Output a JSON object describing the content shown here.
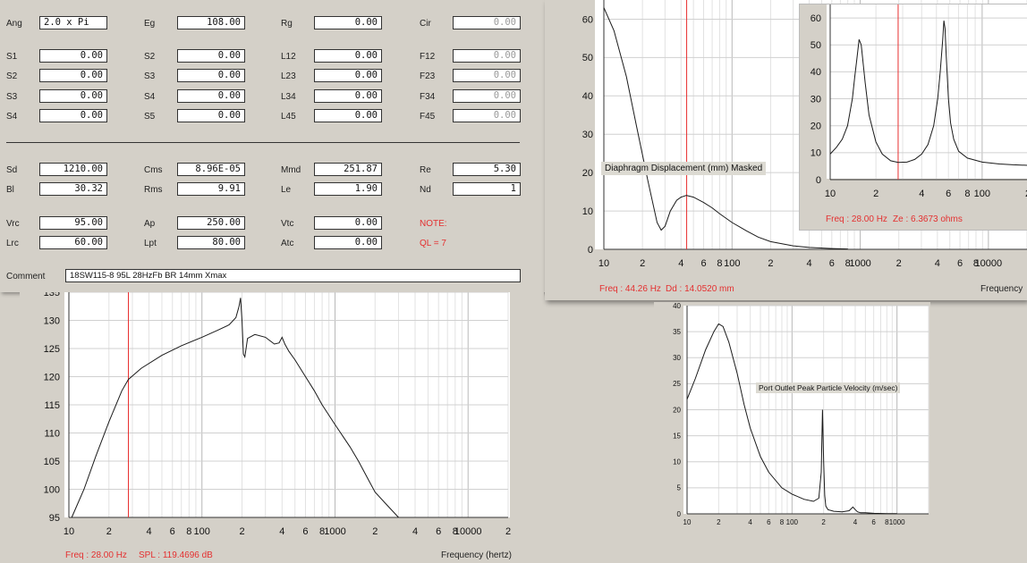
{
  "params": {
    "rows": [
      {
        "key": "ang",
        "cells": [
          {
            "label": "Ang",
            "value": "2.0 x Pi",
            "left": true
          },
          {
            "label": "Eg",
            "value": "108.00"
          },
          {
            "label": "Rg",
            "value": "0.00"
          },
          {
            "label": "Cir",
            "value": "0.00",
            "dim": true
          }
        ]
      },
      {
        "key": "s1",
        "cells": [
          {
            "label": "S1",
            "value": "0.00"
          },
          {
            "label": "S2",
            "value": "0.00"
          },
          {
            "label": "L12",
            "value": "0.00"
          },
          {
            "label": "F12",
            "value": "0.00",
            "dim": true
          }
        ]
      },
      {
        "key": "s2",
        "cells": [
          {
            "label": "S2",
            "value": "0.00"
          },
          {
            "label": "S3",
            "value": "0.00"
          },
          {
            "label": "L23",
            "value": "0.00"
          },
          {
            "label": "F23",
            "value": "0.00",
            "dim": true
          }
        ]
      },
      {
        "key": "s3",
        "cells": [
          {
            "label": "S3",
            "value": "0.00"
          },
          {
            "label": "S4",
            "value": "0.00"
          },
          {
            "label": "L34",
            "value": "0.00"
          },
          {
            "label": "F34",
            "value": "0.00",
            "dim": true
          }
        ]
      },
      {
        "key": "s4",
        "cells": [
          {
            "label": "S4",
            "value": "0.00"
          },
          {
            "label": "S5",
            "value": "0.00"
          },
          {
            "label": "L45",
            "value": "0.00"
          },
          {
            "label": "F45",
            "value": "0.00",
            "dim": true
          }
        ]
      },
      {
        "key": "sd",
        "cells": [
          {
            "label": "Sd",
            "value": "1210.00"
          },
          {
            "label": "Cms",
            "value": "8.96E-05"
          },
          {
            "label": "Mmd",
            "value": "251.87"
          },
          {
            "label": "Re",
            "value": "5.30"
          }
        ]
      },
      {
        "key": "bl",
        "cells": [
          {
            "label": "Bl",
            "value": "30.32"
          },
          {
            "label": "Rms",
            "value": "9.91"
          },
          {
            "label": "Le",
            "value": "1.90"
          },
          {
            "label": "Nd",
            "value": "1"
          }
        ]
      },
      {
        "key": "vrc",
        "cells": [
          {
            "label": "Vrc",
            "value": "95.00"
          },
          {
            "label": "Ap",
            "value": "250.00"
          },
          {
            "label": "Vtc",
            "value": "0.00"
          },
          {
            "label": "NOTE:",
            "value": "",
            "note": true
          }
        ]
      },
      {
        "key": "lrc",
        "cells": [
          {
            "label": "Lrc",
            "value": "60.00"
          },
          {
            "label": "Lpt",
            "value": "80.00"
          },
          {
            "label": "Atc",
            "value": "0.00"
          },
          {
            "label": "QL = 7",
            "value": "",
            "note": true
          }
        ]
      }
    ],
    "comment_label": "Comment",
    "comment_value": "18SW115-8  95L 28HzFb BR 14mm Xmax"
  },
  "spl_chart": {
    "freq_readout": "Freq : 28.00 Hz",
    "spl_readout": "SPL : 119.4696 dB",
    "x_axis_label": "Frequency (hertz)"
  },
  "disp_chart": {
    "overlay_label": "Diaphragm Displacement (mm)   Masked",
    "freq_readout": "Freq : 44.26 Hz",
    "dd_readout": "Dd : 14.0520 mm",
    "x_axis_label": "Frequency"
  },
  "imp_chart": {
    "freq_readout": "Freq : 28.00 Hz",
    "ze_readout": "Ze : 6.3673 ohms"
  },
  "vel_chart": {
    "overlay_label": "Port Outlet Peak Particle Velocity (m/sec)"
  },
  "chart_data": [
    {
      "type": "line",
      "id": "spl",
      "title": "",
      "xlabel": "Frequency (hertz)",
      "ylabel": "",
      "x_scale": "log",
      "xlim": [
        10,
        20000
      ],
      "ylim": [
        95,
        135
      ],
      "y_ticks": [
        95,
        100,
        105,
        110,
        115,
        120,
        125,
        130,
        135
      ],
      "x_tick_labels": [
        "10",
        "2",
        "4",
        "6",
        "8",
        "100",
        "2",
        "4",
        "6",
        "8",
        "1000",
        "2",
        "4",
        "6",
        "8",
        "10000",
        "2"
      ],
      "x_tick_values": [
        10,
        20,
        40,
        60,
        80,
        100,
        200,
        400,
        600,
        800,
        1000,
        2000,
        4000,
        6000,
        8000,
        10000,
        20000
      ],
      "cursor_x": 28,
      "grid": true,
      "series": [
        {
          "x": [
            10.5,
            13,
            16,
            20,
            25,
            28,
            35,
            50,
            70,
            100,
            130,
            160,
            180,
            190,
            195,
            200,
            205,
            210,
            220,
            250,
            300,
            350,
            380,
            400,
            420,
            450,
            500,
            600,
            700,
            800,
            1000,
            1300,
            1500,
            1800,
            2000,
            2500,
            3000
          ],
          "y": [
            95,
            100,
            106,
            112,
            117.5,
            119.5,
            121.5,
            123.8,
            125.5,
            127,
            128.2,
            129.2,
            130.5,
            132.5,
            134,
            130,
            124,
            123.5,
            126.8,
            127.5,
            127,
            125.8,
            126,
            127,
            125.8,
            124.5,
            123,
            120,
            117.5,
            115,
            111.5,
            107.5,
            105,
            101.5,
            99.5,
            97,
            95
          ]
        }
      ]
    },
    {
      "type": "line",
      "id": "displacement",
      "title": "",
      "xlabel": "Frequency",
      "ylabel": "",
      "x_scale": "log",
      "xlim": [
        10,
        20000
      ],
      "ylim": [
        0,
        65
      ],
      "y_ticks": [
        0,
        10,
        20,
        30,
        40,
        50,
        60
      ],
      "x_tick_labels": [
        "10",
        "2",
        "4",
        "6",
        "8",
        "100",
        "2",
        "4",
        "6",
        "8",
        "1000",
        "2",
        "4",
        "6",
        "8",
        "10000"
      ],
      "x_tick_values": [
        10,
        20,
        40,
        60,
        80,
        100,
        200,
        400,
        600,
        800,
        1000,
        2000,
        4000,
        6000,
        8000,
        10000
      ],
      "cursor_x": 44.26,
      "grid": true,
      "series": [
        {
          "x": [
            10,
            12,
            15,
            18,
            22,
            26,
            28,
            30,
            33,
            37,
            40,
            44,
            50,
            60,
            70,
            80,
            100,
            130,
            160,
            200,
            300,
            400,
            600,
            800
          ],
          "y": [
            63,
            57,
            45,
            32,
            18,
            7,
            5,
            6,
            10,
            12.8,
            13.6,
            14.05,
            13.6,
            12.2,
            10.8,
            9.3,
            7,
            4.8,
            3.2,
            2,
            0.9,
            0.5,
            0.2,
            0.1
          ]
        }
      ]
    },
    {
      "type": "line",
      "id": "impedance",
      "title": "",
      "xlabel": "",
      "ylabel": "",
      "x_scale": "log",
      "xlim": [
        10,
        200
      ],
      "ylim": [
        0,
        65
      ],
      "y_ticks": [
        0,
        10,
        20,
        30,
        40,
        50,
        60
      ],
      "x_tick_labels": [
        "10",
        "2",
        "4",
        "6",
        "8",
        "100",
        "2"
      ],
      "x_tick_values": [
        10,
        20,
        40,
        60,
        80,
        100,
        200
      ],
      "cursor_x": 28,
      "grid": true,
      "series": [
        {
          "x": [
            10,
            11,
            12,
            13,
            14,
            14.5,
            15,
            15.5,
            16,
            17,
            18,
            20,
            22,
            25,
            28,
            32,
            36,
            40,
            44,
            48,
            51,
            53,
            55,
            56,
            57,
            58,
            60,
            62,
            65,
            70,
            80,
            100,
            130,
            160,
            200
          ],
          "y": [
            9.5,
            12,
            15,
            20,
            30,
            38,
            45,
            52,
            50,
            36,
            24,
            14,
            9.5,
            7,
            6.37,
            6.5,
            7.5,
            9.5,
            13,
            20,
            30,
            40,
            52,
            59,
            56,
            46,
            30,
            21,
            15,
            10.5,
            8,
            6.5,
            5.8,
            5.5,
            5.3
          ]
        }
      ]
    },
    {
      "type": "line",
      "id": "port_velocity",
      "title": "Port Outlet Peak Particle Velocity (m/sec)",
      "xlabel": "",
      "ylabel": "",
      "x_scale": "log",
      "xlim": [
        10,
        2000
      ],
      "ylim": [
        0,
        40
      ],
      "y_ticks": [
        0,
        5,
        10,
        15,
        20,
        25,
        30,
        35,
        40
      ],
      "x_tick_labels": [
        "10",
        "2",
        "4",
        "6",
        "8",
        "100",
        "2",
        "4",
        "6",
        "8",
        "1000"
      ],
      "x_tick_values": [
        10,
        20,
        40,
        60,
        80,
        100,
        200,
        400,
        600,
        800,
        1000
      ],
      "grid": true,
      "series": [
        {
          "x": [
            10,
            12,
            15,
            18,
            20,
            22,
            25,
            30,
            35,
            40,
            50,
            60,
            80,
            100,
            130,
            160,
            180,
            190,
            195,
            200,
            205,
            210,
            220,
            250,
            300,
            350,
            380,
            400,
            420,
            450,
            500,
            600,
            800,
            1000
          ],
          "y": [
            22,
            26,
            31.5,
            35,
            36.5,
            36,
            33,
            27,
            21,
            16.5,
            11,
            8,
            5,
            3.8,
            2.8,
            2.4,
            3,
            8,
            20,
            10,
            3.5,
            1.5,
            0.8,
            0.5,
            0.4,
            0.6,
            1.3,
            0.8,
            0.4,
            0.2,
            0.2,
            0.1,
            0.05,
            0.05
          ]
        }
      ]
    }
  ]
}
